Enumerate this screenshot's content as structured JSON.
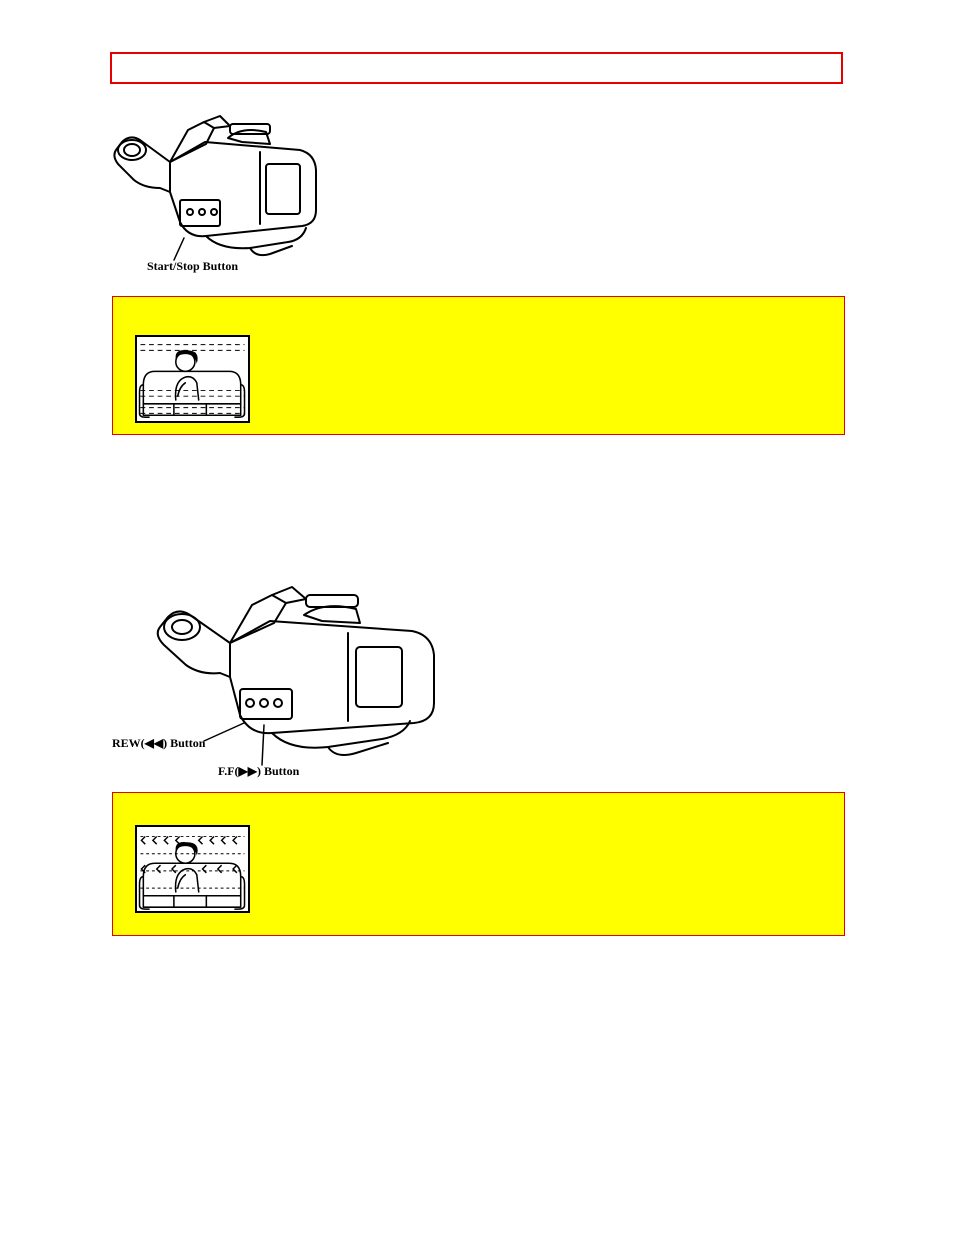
{
  "labels": {
    "start_stop": "Start/Stop Button",
    "rew": "REW(◀◀) Button",
    "ff": "F.F(▶▶) Button"
  }
}
